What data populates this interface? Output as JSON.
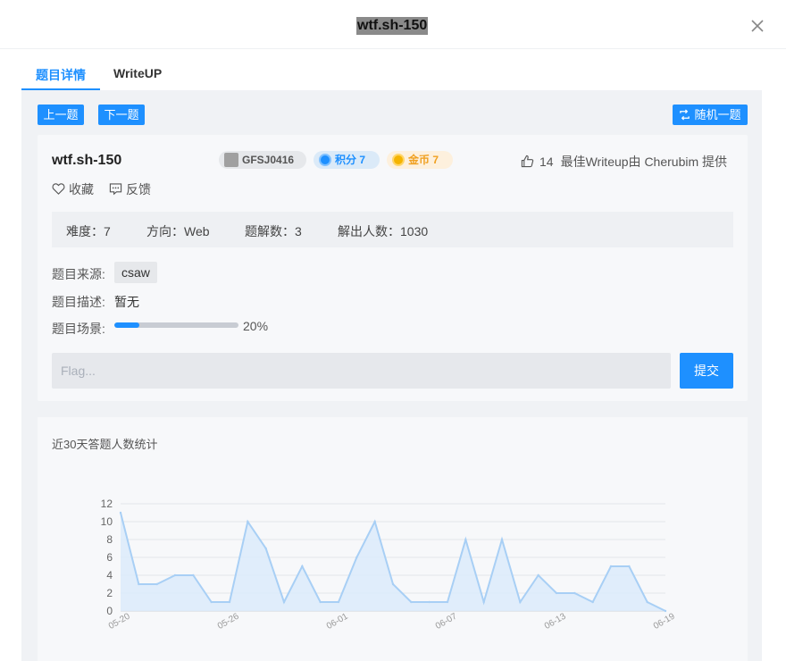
{
  "modal": {
    "title": "wtf.sh-150"
  },
  "tabs": [
    {
      "label": "题目详情",
      "active": true
    },
    {
      "label": "WriteUP",
      "active": false
    }
  ],
  "nav": {
    "prev": "上一题",
    "next": "下一题",
    "random": "随机一题"
  },
  "challenge": {
    "title": "wtf.sh-150",
    "code": "GFSJ0416",
    "score": "积分 7",
    "coins": "金币 7",
    "likes": "14",
    "best_writeup": "最佳Writeup由 Cherubim 提供",
    "favorite": "收藏",
    "feedback": "反馈",
    "stats": {
      "difficulty": "难度：7",
      "direction": "方向：Web",
      "writeups": "题解数：3",
      "solvers": "解出人数：1030"
    },
    "source_label": "题目来源:",
    "source_value": "csaw",
    "desc_label": "题目描述:",
    "desc_value": "暂无",
    "scene_label": "题目场景:",
    "scene_progress": 0.2,
    "scene_progress_text": "20%"
  },
  "flag": {
    "placeholder": "Flag...",
    "submit": "提交"
  },
  "colors": {
    "accent": "#1e90ff",
    "coin": "#f5b400",
    "chart_line": "#a8cff5",
    "chart_fill": "#dcebfa"
  },
  "chart_data": {
    "type": "area",
    "title": "近30天答题人数统计",
    "x": [
      "05-20",
      "05-21",
      "05-22",
      "05-23",
      "05-24",
      "05-25",
      "05-26",
      "05-27",
      "05-28",
      "05-29",
      "05-30",
      "05-31",
      "06-01",
      "06-02",
      "06-03",
      "06-04",
      "06-05",
      "06-06",
      "06-07",
      "06-08",
      "06-09",
      "06-10",
      "06-11",
      "06-12",
      "06-13",
      "06-14",
      "06-15",
      "06-16",
      "06-17",
      "06-18",
      "06-19"
    ],
    "values": [
      11,
      3,
      3,
      4,
      4,
      1,
      1,
      10,
      7,
      1,
      5,
      1,
      1,
      6,
      10,
      3,
      1,
      1,
      1,
      8,
      1,
      8,
      1,
      4,
      2,
      2,
      1,
      5,
      5,
      1,
      0
    ],
    "xtick_labels": [
      "05-20",
      "05-26",
      "06-01",
      "06-07",
      "06-13",
      "06-19"
    ],
    "yticks": [
      0,
      2,
      4,
      6,
      8,
      10,
      12
    ],
    "ylim": [
      0,
      12
    ],
    "grid": true
  }
}
